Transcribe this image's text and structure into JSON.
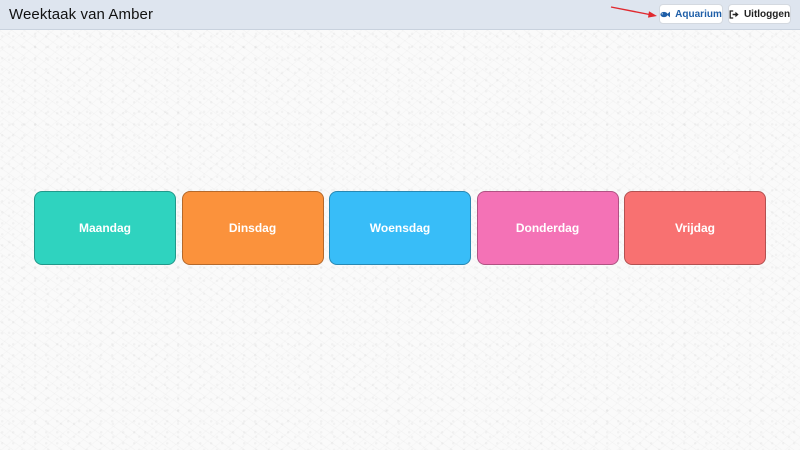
{
  "header": {
    "title": "Weektaak van Amber",
    "aquarium_label": "Aquarium",
    "aquarium_icon": "fish-icon",
    "logout_label": "Uitloggen",
    "logout_icon": "sign-out-icon"
  },
  "colors": {
    "header_bg": "#dee5ef",
    "aquarium_text": "#1f5fa8",
    "arrow": "#e0282e"
  },
  "days": [
    {
      "label": "Maandag",
      "color": "#2fd3bf"
    },
    {
      "label": "Dinsdag",
      "color": "#fb923c"
    },
    {
      "label": "Woensdag",
      "color": "#38bdf8"
    },
    {
      "label": "Donderdag",
      "color": "#f472b6"
    },
    {
      "label": "Vrijdag",
      "color": "#f87171"
    }
  ]
}
